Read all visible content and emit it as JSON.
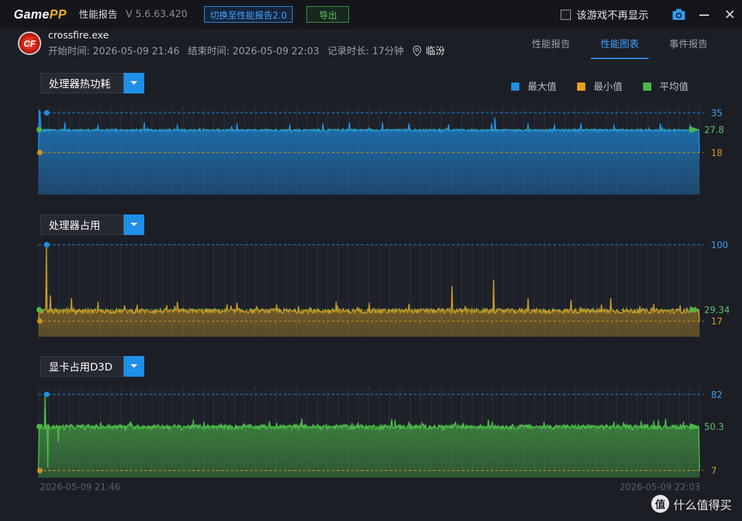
{
  "window": {
    "logo_main": "Game",
    "logo_accent": "PP",
    "title": "性能报告",
    "version": "V 5.6.63.420",
    "switch_button": "切换至性能报告2.0",
    "export_button": "导出",
    "hide_label": "该游戏不再显示",
    "icons": [
      "camera-icon",
      "minimize-icon",
      "close-icon"
    ]
  },
  "session": {
    "game_icon_text": "CF",
    "game_name": "crossfire.exe",
    "start": "开始时间: 2026-05-09 21:46",
    "end": "结束时间: 2026-05-09 22:03",
    "duration": "记录时长: 17分钟",
    "location": "临汾"
  },
  "tabs": [
    {
      "label": "性能报告",
      "active": false
    },
    {
      "label": "性能图表",
      "active": true
    },
    {
      "label": "事件报告",
      "active": false
    }
  ],
  "legend": [
    {
      "label": "最大值",
      "color": "#1e8fe6"
    },
    {
      "label": "最小值",
      "color": "#e6a11c"
    },
    {
      "label": "平均值",
      "color": "#4cb848"
    }
  ],
  "chart_data": [
    {
      "type": "area",
      "title": "处理器热功耗",
      "color": "#1e8fe6",
      "max": 35,
      "min": 18,
      "avg": 27.8,
      "max_label": "35",
      "min_label": "18",
      "avg_label": "27.8",
      "ylim": [
        0,
        38
      ],
      "baseline": 27.5,
      "spikes": [
        [
          1,
          36
        ],
        [
          2,
          36
        ],
        [
          3,
          32
        ],
        [
          40,
          31
        ],
        [
          90,
          30
        ],
        [
          160,
          31
        ],
        [
          210,
          30
        ],
        [
          300,
          30.5
        ],
        [
          380,
          30
        ],
        [
          430,
          30.5
        ],
        [
          470,
          31
        ],
        [
          520,
          31
        ],
        [
          560,
          30.5
        ],
        [
          620,
          30
        ],
        [
          685,
          30.5
        ],
        [
          690,
          33
        ],
        [
          740,
          30.5
        ],
        [
          780,
          30
        ],
        [
          820,
          30.5
        ],
        [
          870,
          30
        ],
        [
          940,
          30.5
        ],
        [
          985,
          30
        ]
      ]
    },
    {
      "type": "area",
      "title": "处理器占用",
      "color": "#c89628",
      "max": 100,
      "min": 17,
      "avg": 29.34,
      "max_label": "100",
      "min_label": "17",
      "avg_label": "29.34",
      "ylim": [
        0,
        100
      ],
      "baseline": 28,
      "spikes": [
        [
          12,
          100
        ],
        [
          18,
          45
        ],
        [
          50,
          42
        ],
        [
          90,
          38
        ],
        [
          130,
          34
        ],
        [
          210,
          38
        ],
        [
          300,
          37
        ],
        [
          360,
          35
        ],
        [
          450,
          38
        ],
        [
          500,
          37
        ],
        [
          560,
          36
        ],
        [
          625,
          55
        ],
        [
          688,
          62
        ],
        [
          740,
          42
        ],
        [
          805,
          40
        ],
        [
          865,
          42
        ],
        [
          930,
          36
        ],
        [
          970,
          34
        ]
      ]
    },
    {
      "type": "area",
      "title": "显卡占用D3D",
      "color": "#4cb848",
      "max": 82,
      "min": 7,
      "avg": 50.3,
      "max_label": "82",
      "min_label": "7",
      "avg_label": "50.3",
      "ylim": [
        0,
        90
      ],
      "baseline": 50,
      "spikes": [
        [
          10,
          82
        ],
        [
          14,
          10
        ],
        [
          30,
          35
        ],
        [
          140,
          54
        ],
        [
          250,
          55
        ],
        [
          360,
          54
        ],
        [
          460,
          52
        ],
        [
          560,
          55
        ],
        [
          630,
          55
        ],
        [
          680,
          57
        ],
        [
          740,
          52
        ],
        [
          810,
          50
        ],
        [
          870,
          55
        ],
        [
          930,
          56
        ],
        [
          985,
          50
        ]
      ]
    }
  ],
  "x_axis": {
    "start": "2026-05-09 21:46",
    "end": "2026-05-09 22:03"
  },
  "watermark": {
    "icon": "值",
    "text": "什么值得买"
  }
}
